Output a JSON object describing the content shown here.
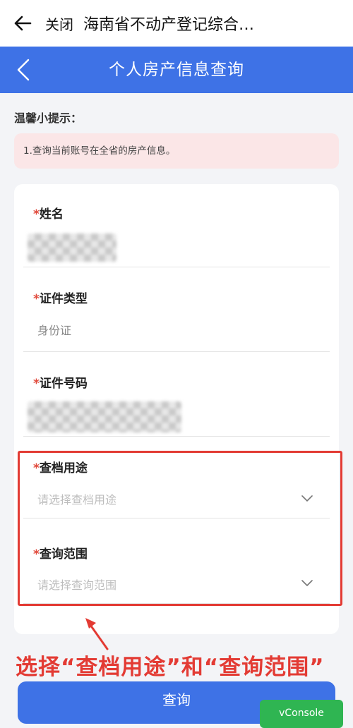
{
  "topbar": {
    "close_label": "关闭",
    "title": "海南省不动产登记综合…"
  },
  "navbar": {
    "title": "个人房产信息查询"
  },
  "tips": {
    "title": "温馨小提示：",
    "text": "1.查询当前账号在全省的房产信息。"
  },
  "form": {
    "required_mark": "*",
    "fields": [
      {
        "label": "姓名",
        "value": ""
      },
      {
        "label": "证件类型",
        "value": "身份证"
      },
      {
        "label": "证件号码",
        "value": ""
      },
      {
        "label": "查档用途",
        "placeholder": "请选择查档用途"
      },
      {
        "label": "查询范围",
        "placeholder": "请选择查询范围"
      }
    ]
  },
  "annotation": {
    "text": "选择“查档用途”和“查询范围”"
  },
  "actions": {
    "query_label": "查询",
    "vconsole_label": "vConsole"
  },
  "icons": {
    "back": "arrow-left-icon",
    "nav_back": "chevron-left-icon",
    "dropdown": "chevron-down-icon"
  },
  "colors": {
    "primary": "#3e72e6",
    "required": "#e14a3c",
    "annotation": "#e33b34",
    "tip_bg": "#fbe6e7",
    "vconsole": "#2fb552"
  }
}
